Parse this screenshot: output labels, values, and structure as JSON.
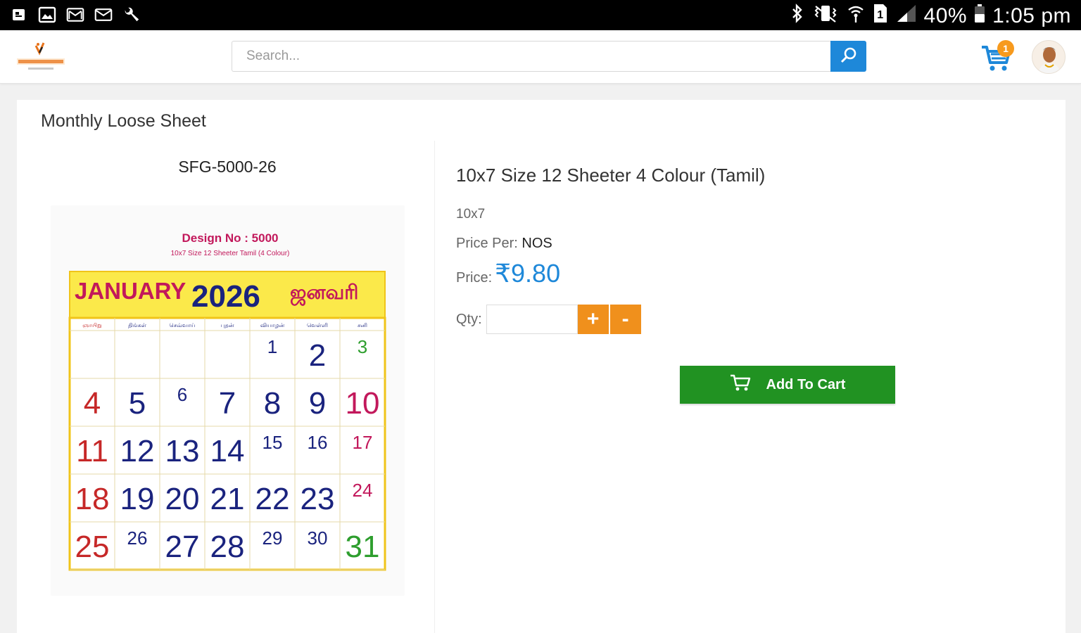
{
  "status_bar": {
    "left_icons": [
      "notification-icon",
      "gallery-icon",
      "gmail-icon",
      "email-icon",
      "wrench-icon"
    ],
    "right_icons": [
      "bluetooth-icon",
      "vibrate-icon",
      "wifi-icon",
      "sim-icon",
      "signal-icon",
      "battery-icon"
    ],
    "battery": "40%",
    "time": "1:05 pm"
  },
  "header": {
    "search": {
      "placeholder": "Search..."
    },
    "cart_count": "1"
  },
  "page": {
    "section_title": "Monthly Loose Sheet",
    "sku": "SFG-5000-26"
  },
  "product": {
    "title": "10x7 Size 12 Sheeter 4 Colour (Tamil)",
    "size": "10x7",
    "price_per_label": "Price Per:",
    "price_per_value": "NOS",
    "price_label": "Price:",
    "price_value": "₹9.80",
    "qty_label": "Qty:",
    "qty_value": "",
    "plus_label": "+",
    "minus_label": "-",
    "add_to_cart_label": "Add To Cart"
  },
  "calendar_image": {
    "design_label": "Design No : 5000",
    "subtitle": "10x7 Size 12 Sheeter Tamil (4 Colour)",
    "month": "JANUARY",
    "year": "2026",
    "month_tamil": "ஜனவரி",
    "weekdays": [
      "ஞாயிறு",
      "திங்கள்",
      "செவ்வாய்",
      "புதன்",
      "வியாழன்",
      "வெள்ளி",
      "சனி"
    ],
    "days": [
      "1",
      "2",
      "3",
      "4",
      "5",
      "6",
      "7",
      "8",
      "9",
      "10",
      "11",
      "12",
      "13",
      "14",
      "15",
      "16",
      "17",
      "18",
      "19",
      "20",
      "21",
      "22",
      "23",
      "24",
      "25",
      "26",
      "27",
      "28",
      "29",
      "30",
      "31"
    ]
  },
  "colors": {
    "accent_blue": "#1e88d9",
    "orange": "#f0901c",
    "green": "#219222",
    "badge": "#f79a1d"
  }
}
